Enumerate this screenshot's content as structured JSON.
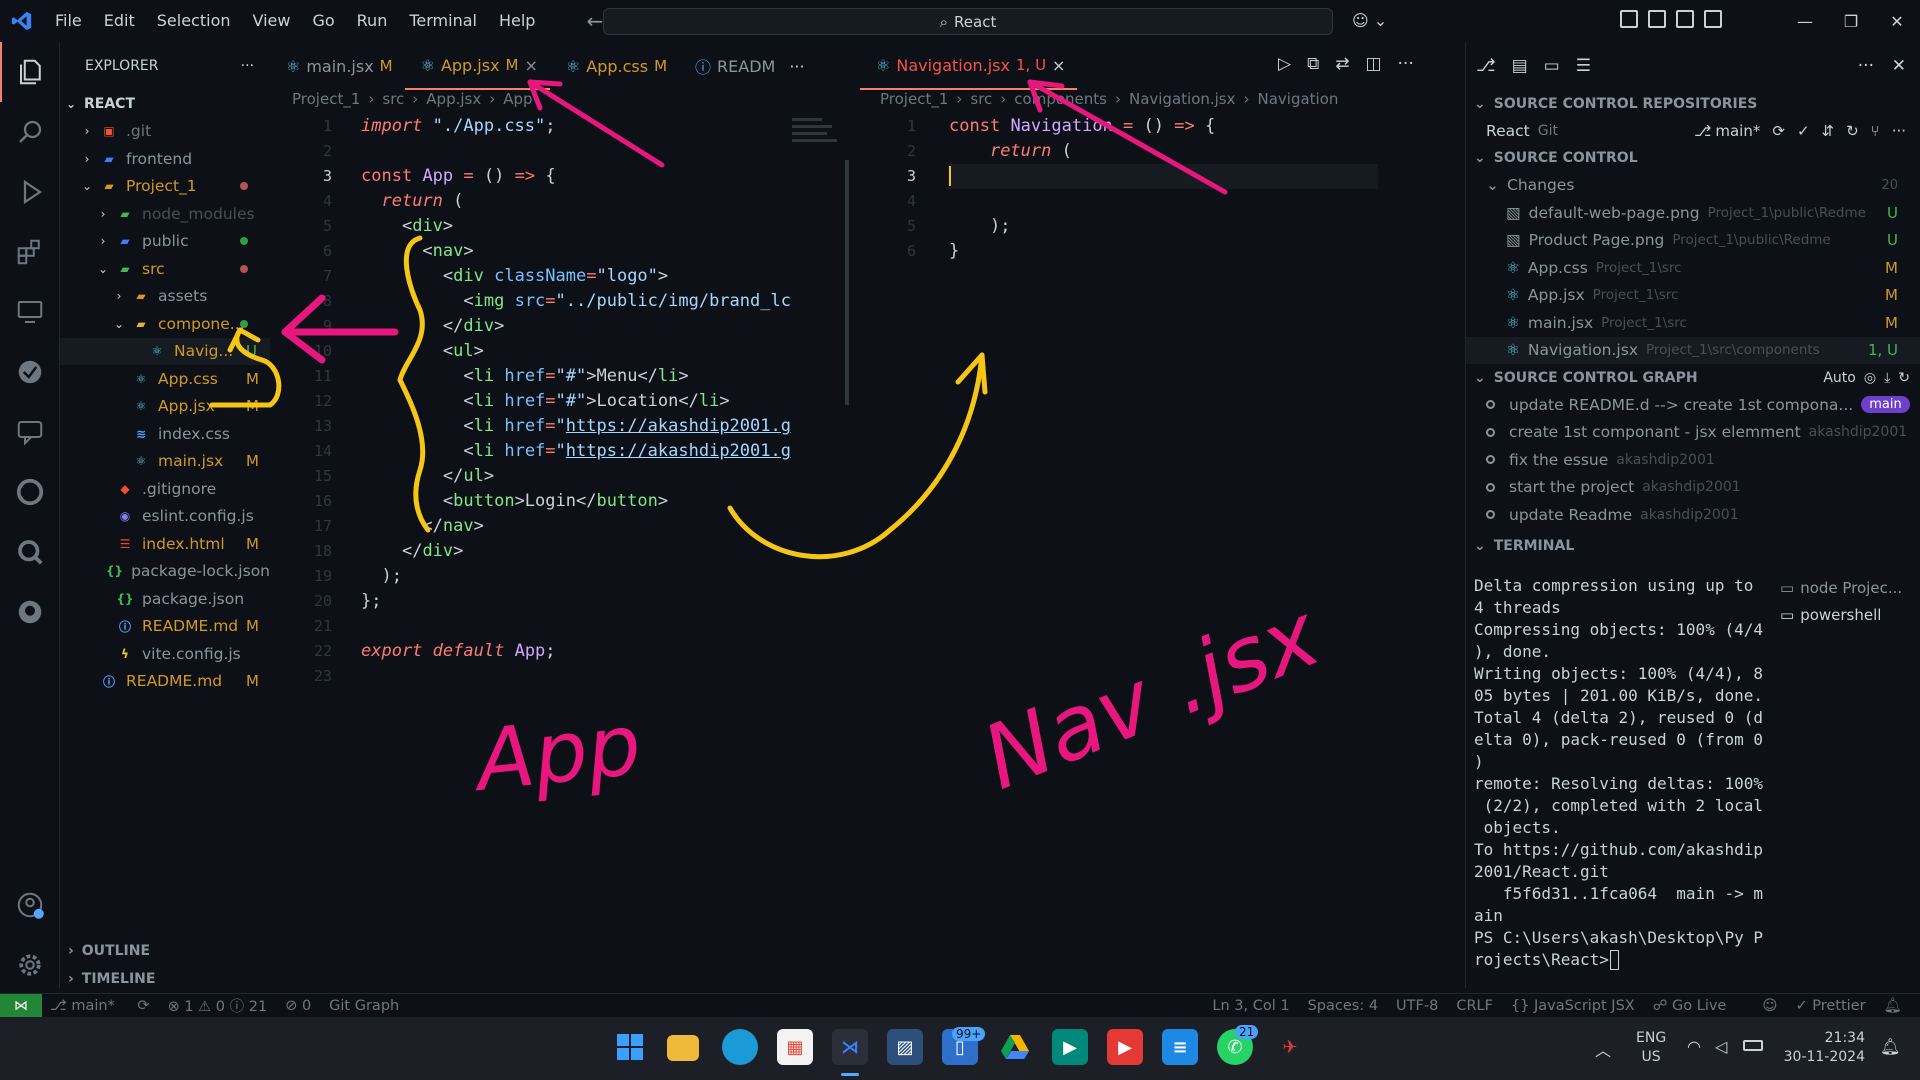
{
  "titlebar": {
    "menus": [
      "File",
      "Edit",
      "Selection",
      "View",
      "Go",
      "Run",
      "Terminal",
      "Help"
    ],
    "search": "React"
  },
  "explorer": {
    "title": "EXPLORER",
    "root": "REACT",
    "items": [
      {
        "label": ".git",
        "depth": 1,
        "chev": "›",
        "icon": "git-folder",
        "color": "#6e7681"
      },
      {
        "label": "frontend",
        "depth": 1,
        "chev": "›",
        "icon": "folder-blue",
        "color": "#8b949e"
      },
      {
        "label": "Project_1",
        "depth": 1,
        "chev": "⌄",
        "icon": "folder",
        "color": "#d29922",
        "dot": "#b3554e"
      },
      {
        "label": "node_modules",
        "depth": 2,
        "chev": "›",
        "icon": "folder-green",
        "color": "#484f58"
      },
      {
        "label": "public",
        "depth": 2,
        "chev": "›",
        "icon": "folder-blue",
        "color": "#8b949e",
        "dot": "#2ea043"
      },
      {
        "label": "src",
        "depth": 2,
        "chev": "⌄",
        "icon": "folder-green",
        "color": "#d29922",
        "dot": "#b3554e"
      },
      {
        "label": "assets",
        "depth": 3,
        "chev": "›",
        "icon": "folder",
        "color": "#8b949e"
      },
      {
        "label": "compone...",
        "depth": 3,
        "chev": "⌄",
        "icon": "folder-yellow",
        "color": "#d29922",
        "dot": "#2ea043"
      },
      {
        "label": "Navig...",
        "depth": 4,
        "chev": "",
        "icon": "react",
        "color": "#d29922",
        "badge": "U"
      },
      {
        "label": "App.css",
        "depth": 3,
        "chev": "",
        "icon": "react",
        "color": "#d29922",
        "badge": "M"
      },
      {
        "label": "App.jsx",
        "depth": 3,
        "chev": "",
        "icon": "react",
        "color": "#d29922",
        "badge": "M"
      },
      {
        "label": "index.css",
        "depth": 3,
        "chev": "",
        "icon": "css",
        "color": "#8b949e"
      },
      {
        "label": "main.jsx",
        "depth": 3,
        "chev": "",
        "icon": "react",
        "color": "#d29922",
        "badge": "M"
      },
      {
        "label": ".gitignore",
        "depth": 2,
        "chev": "",
        "icon": "git",
        "color": "#8b949e"
      },
      {
        "label": "eslint.config.js",
        "depth": 2,
        "chev": "",
        "icon": "eslint",
        "color": "#8b949e"
      },
      {
        "label": "index.html",
        "depth": 2,
        "chev": "",
        "icon": "html",
        "color": "#d29922",
        "badge": "M"
      },
      {
        "label": "package-lock.json",
        "depth": 2,
        "chev": "",
        "icon": "json",
        "color": "#8b949e"
      },
      {
        "label": "package.json",
        "depth": 2,
        "chev": "",
        "icon": "json",
        "color": "#8b949e"
      },
      {
        "label": "README.md",
        "depth": 2,
        "chev": "",
        "icon": "info",
        "color": "#d29922",
        "badge": "M"
      },
      {
        "label": "vite.config.js",
        "depth": 2,
        "chev": "",
        "icon": "vite",
        "color": "#8b949e"
      },
      {
        "label": "README.md",
        "depth": 1,
        "chev": "",
        "icon": "info",
        "color": "#d29922",
        "badge": "M"
      }
    ],
    "outline": "OUTLINE",
    "timeline": "TIMELINE"
  },
  "editor1": {
    "tabs": [
      {
        "label": "main.jsx",
        "status": "M"
      },
      {
        "label": "App.jsx",
        "status": "M",
        "close": "×"
      },
      {
        "label": "App.css",
        "status": "M"
      },
      {
        "label": "READM",
        "status": ""
      }
    ],
    "more": "···",
    "crumbs": [
      "Project_1",
      "›",
      "src",
      "›",
      "App.jsx",
      "›",
      "App"
    ],
    "lines": [
      "1",
      "2",
      "3",
      "4",
      "5",
      "6",
      "7",
      "8",
      "9",
      "10",
      "11",
      "12",
      "13",
      "14",
      "15",
      "16",
      "17",
      "18",
      "19",
      "20",
      "21",
      "22",
      "23"
    ]
  },
  "editor2": {
    "tab": {
      "label": "Navigation.jsx",
      "status": "1, U",
      "close": "×"
    },
    "crumbs": [
      "Project_1",
      "›",
      "src",
      "›",
      "components",
      "›",
      "Navigation.jsx",
      "›",
      "Navigation"
    ],
    "lines": [
      "1",
      "2",
      "3",
      "4",
      "5",
      "6"
    ]
  },
  "scm": {
    "repos_title": "SOURCE CONTROL REPOSITORIES",
    "repo_name": "React",
    "repo_type": "Git",
    "branch": "main*",
    "sc_title": "SOURCE CONTROL",
    "changes_label": "Changes",
    "changes_count": "20",
    "changes": [
      {
        "name": "default-web-page.png",
        "path": "Project_1\\public\\Redme",
        "status": "U"
      },
      {
        "name": "Product Page.png",
        "path": "Project_1\\public\\Redme",
        "status": "U"
      },
      {
        "name": "App.css",
        "path": "Project_1\\src",
        "status": "M"
      },
      {
        "name": "App.jsx",
        "path": "Project_1\\src",
        "status": "M"
      },
      {
        "name": "main.jsx",
        "path": "Project_1\\src",
        "status": "M"
      },
      {
        "name": "Navigation.jsx",
        "path": "Project_1\\src\\components",
        "status": "1, U"
      }
    ],
    "graph_title": "SOURCE CONTROL GRAPH",
    "graph_auto": "Auto",
    "graph": [
      {
        "msg": "update README.d --> create 1st compona...",
        "author": "",
        "tag": "main"
      },
      {
        "msg": "create 1st componant - jsx elemment",
        "author": "akashdip2001"
      },
      {
        "msg": "fix the essue",
        "author": "akashdip2001"
      },
      {
        "msg": "start the project",
        "author": "akashdip2001"
      },
      {
        "msg": "update Readme",
        "author": "akashdip2001"
      }
    ],
    "terminal_title": "TERMINAL",
    "terminals": [
      "node Projec...",
      "powershell"
    ],
    "terminal_output": "Delta compression using up to\n4 threads\nCompressing objects: 100% (4/4\n), done.\nWriting objects: 100% (4/4), 8\n05 bytes | 201.00 KiB/s, done.\nTotal 4 (delta 2), reused 0 (d\nelta 0), pack-reused 0 (from 0\n)\nremote: Resolving deltas: 100%\n (2/2), completed with 2 local\n objects.\nTo https://github.com/akashdip\n2001/React.git\n   f5f6d31..1fca064  main -> m\nain\nPS C:\\Users\\akash\\Desktop\\Py P\nrojects\\React>"
  },
  "statusbar": {
    "branch": "main*",
    "problems": "⊗ 1 ⚠ 0 ⓘ 21",
    "ports": "⊘ 0",
    "git_graph": "Git Graph",
    "position": "Ln 3, Col 1",
    "spaces": "Spaces: 4",
    "encoding": "UTF-8",
    "eol": "CRLF",
    "language": "{} JavaScript JSX",
    "golive": "Go Live",
    "prettier": "✓ Prettier"
  },
  "taskbar": {
    "lang": "ENG",
    "region": "US",
    "time": "21:34",
    "date": "30-11-2024",
    "badge_phone": "99+",
    "badge_whatsapp": "21"
  },
  "annotations": {
    "app_label": "App",
    "nav_label": "Nav .jsx"
  },
  "colors": {
    "background": "#0d1117",
    "pink_ink": "#e8177e",
    "yellow_ink": "#f5c518",
    "accent": "#58a6ff"
  }
}
